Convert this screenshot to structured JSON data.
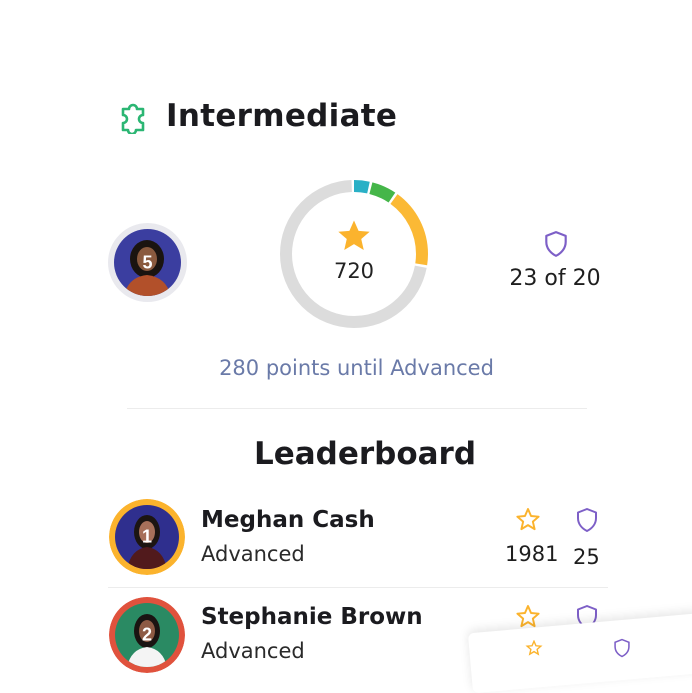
{
  "header": {
    "level_title": "Intermediate",
    "icon": "puzzle-icon"
  },
  "progress": {
    "rank": "5",
    "points": "720",
    "badges": "23 of 20",
    "until_text": "280 points until Advanced",
    "ring_segments": [
      {
        "color": "#2ab0c6",
        "fraction": 0.04
      },
      {
        "color": "#45b649",
        "fraction": 0.06
      },
      {
        "color": "#fbb935",
        "fraction": 0.18
      },
      {
        "color": "#dcdcdc",
        "fraction": 0.72
      }
    ]
  },
  "leaderboard": {
    "title": "Leaderboard",
    "rows": [
      {
        "rank": "1",
        "name": "Meghan Cash",
        "level": "Advanced",
        "points": "1981",
        "badges": "25",
        "ring_color": "#fbb32d"
      },
      {
        "rank": "2",
        "name": "Stephanie Brown",
        "level": "Advanced",
        "points": "",
        "badges": "",
        "ring_color": "#e0523d"
      }
    ]
  },
  "colors": {
    "accent_green": "#2bb673",
    "star": "#fbb32d",
    "shield": "#7d5fc7",
    "muted_text": "#6a7aa8"
  }
}
